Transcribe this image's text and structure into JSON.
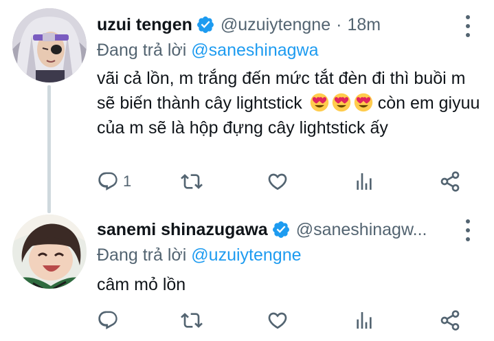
{
  "colors": {
    "link": "#1d9bf0",
    "secondary_text": "#536471",
    "primary_text": "#0f1419",
    "thread_line": "#cfd9de"
  },
  "tweets": [
    {
      "display_name": "uzui tengen",
      "handle": "@uzuiytengne",
      "separator": "·",
      "time": "18m",
      "reply_prefix": "Đang trả lời",
      "reply_mention": "@saneshinagwa",
      "text": "vãi cả lồn, m trắng đến mức tắt đèn đi thì buồi m sẽ biến thành cây lightstick",
      "text_end": "còn em giyuu của m sẽ là hộp đựng cây lightstick ấy",
      "emojis": [
        "heart-eyes-emoji",
        "heart-eyes-emoji",
        "heart-eyes-emoji"
      ],
      "reply_count": "1"
    },
    {
      "display_name": "sanemi shinazugawa",
      "handle": "@saneshinagw...",
      "reply_prefix": "Đang trả lời",
      "reply_mention": "@uzuiytengne",
      "text": "câm mỏ lồn"
    }
  ]
}
